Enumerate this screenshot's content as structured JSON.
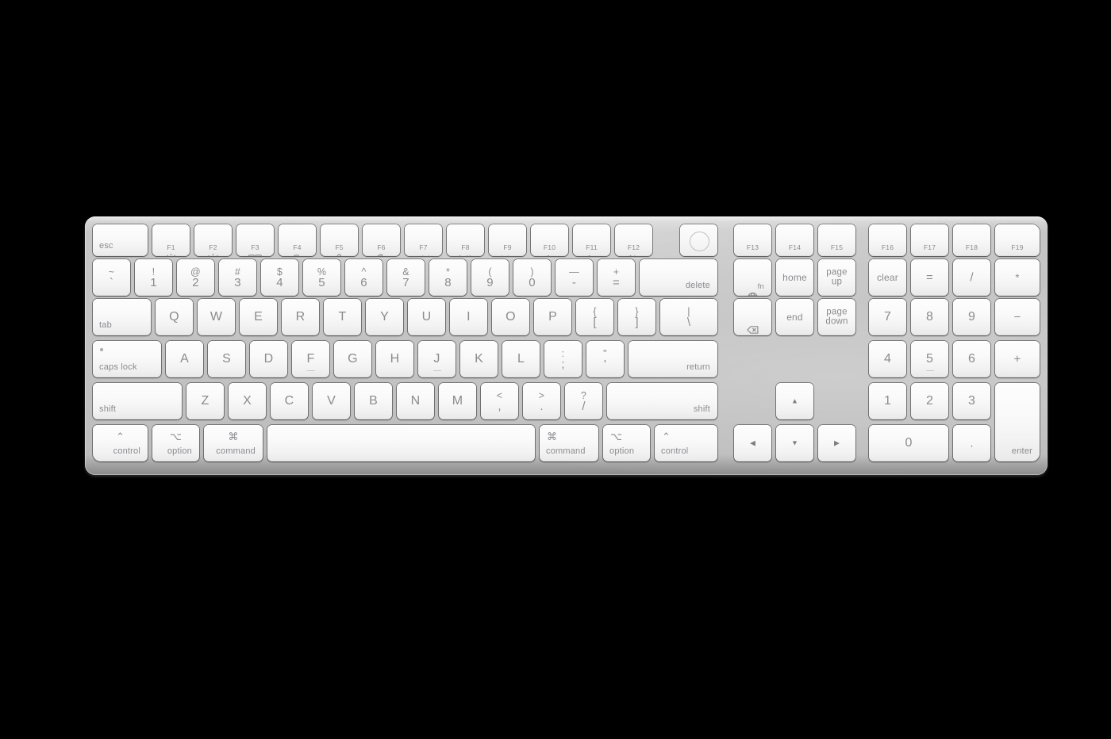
{
  "product": {
    "name": "Magic Keyboard with Touch ID and Numeric Keypad",
    "layout": "US English",
    "body_color": "#c2c2c2",
    "key_color": "#fafafa",
    "legend_color": "#8b8b8f"
  },
  "rows": {
    "function_row": [
      {
        "name": "esc",
        "label": "esc"
      },
      {
        "name": "f1",
        "icon": "brightness-down-icon",
        "fnum": "F1"
      },
      {
        "name": "f2",
        "icon": "brightness-up-icon",
        "fnum": "F2"
      },
      {
        "name": "f3",
        "icon": "mission-control-icon",
        "fnum": "F3"
      },
      {
        "name": "f4",
        "icon": "spotlight-search-icon",
        "fnum": "F4"
      },
      {
        "name": "f5",
        "icon": "dictation-microphone-icon",
        "fnum": "F5"
      },
      {
        "name": "f6",
        "icon": "do-not-disturb-moon-icon",
        "fnum": "F6"
      },
      {
        "name": "f7",
        "icon": "rewind-icon",
        "fnum": "F7"
      },
      {
        "name": "f8",
        "icon": "play-pause-icon",
        "fnum": "F8"
      },
      {
        "name": "f9",
        "icon": "fast-forward-icon",
        "fnum": "F9"
      },
      {
        "name": "f10",
        "icon": "mute-icon",
        "fnum": "F10"
      },
      {
        "name": "f11",
        "icon": "volume-down-icon",
        "fnum": "F11"
      },
      {
        "name": "f12",
        "icon": "volume-up-icon",
        "fnum": "F12"
      },
      {
        "name": "touch-id",
        "icon": "touch-id-icon"
      }
    ],
    "number_row": [
      {
        "name": "backtick",
        "top": "~",
        "bottom": "`"
      },
      {
        "name": "digit-1",
        "top": "!",
        "bottom": "1"
      },
      {
        "name": "digit-2",
        "top": "@",
        "bottom": "2"
      },
      {
        "name": "digit-3",
        "top": "#",
        "bottom": "3"
      },
      {
        "name": "digit-4",
        "top": "$",
        "bottom": "4"
      },
      {
        "name": "digit-5",
        "top": "%",
        "bottom": "5"
      },
      {
        "name": "digit-6",
        "top": "^",
        "bottom": "6"
      },
      {
        "name": "digit-7",
        "top": "&",
        "bottom": "7"
      },
      {
        "name": "digit-8",
        "top": "*",
        "bottom": "8"
      },
      {
        "name": "digit-9",
        "top": "(",
        "bottom": "9"
      },
      {
        "name": "digit-0",
        "top": ")",
        "bottom": "0"
      },
      {
        "name": "minus",
        "top": "—",
        "bottom": "-"
      },
      {
        "name": "equal",
        "top": "+",
        "bottom": "="
      },
      {
        "name": "delete",
        "label": "delete"
      }
    ],
    "top_letter_row": [
      {
        "name": "tab",
        "label": "tab"
      },
      {
        "name": "key-q",
        "label": "Q"
      },
      {
        "name": "key-w",
        "label": "W"
      },
      {
        "name": "key-e",
        "label": "E"
      },
      {
        "name": "key-r",
        "label": "R"
      },
      {
        "name": "key-t",
        "label": "T"
      },
      {
        "name": "key-y",
        "label": "Y"
      },
      {
        "name": "key-u",
        "label": "U"
      },
      {
        "name": "key-i",
        "label": "I"
      },
      {
        "name": "key-o",
        "label": "O"
      },
      {
        "name": "key-p",
        "label": "P"
      },
      {
        "name": "bracket-left",
        "top": "{",
        "bottom": "["
      },
      {
        "name": "bracket-right",
        "top": "}",
        "bottom": "]"
      },
      {
        "name": "backslash",
        "top": "|",
        "bottom": "\\"
      }
    ],
    "home_row": [
      {
        "name": "caps-lock",
        "label": "caps lock"
      },
      {
        "name": "key-a",
        "label": "A"
      },
      {
        "name": "key-s",
        "label": "S"
      },
      {
        "name": "key-d",
        "label": "D"
      },
      {
        "name": "key-f",
        "label": "F"
      },
      {
        "name": "key-g",
        "label": "G"
      },
      {
        "name": "key-h",
        "label": "H"
      },
      {
        "name": "key-j",
        "label": "J"
      },
      {
        "name": "key-k",
        "label": "K"
      },
      {
        "name": "key-l",
        "label": "L"
      },
      {
        "name": "semicolon",
        "top": ":",
        "bottom": ";"
      },
      {
        "name": "quote",
        "top": "\"",
        "bottom": "'"
      },
      {
        "name": "return",
        "label": "return"
      }
    ],
    "bottom_letter_row": [
      {
        "name": "shift-left",
        "label": "shift"
      },
      {
        "name": "key-z",
        "label": "Z"
      },
      {
        "name": "key-x",
        "label": "X"
      },
      {
        "name": "key-c",
        "label": "C"
      },
      {
        "name": "key-v",
        "label": "V"
      },
      {
        "name": "key-b",
        "label": "B"
      },
      {
        "name": "key-n",
        "label": "N"
      },
      {
        "name": "key-m",
        "label": "M"
      },
      {
        "name": "comma",
        "top": "<",
        "bottom": ","
      },
      {
        "name": "period",
        "top": ">",
        "bottom": "."
      },
      {
        "name": "slash",
        "top": "?",
        "bottom": "/"
      },
      {
        "name": "shift-right",
        "label": "shift"
      }
    ],
    "modifier_row": [
      {
        "name": "control-left",
        "glyph": "⌃",
        "label": "control"
      },
      {
        "name": "option-left",
        "glyph": "⌥",
        "label": "option"
      },
      {
        "name": "command-left",
        "glyph": "⌘",
        "label": "command"
      },
      {
        "name": "space",
        "label": ""
      },
      {
        "name": "command-right",
        "glyph": "⌘",
        "label": "command"
      },
      {
        "name": "option-right",
        "glyph": "⌥",
        "label": "option"
      },
      {
        "name": "control-right",
        "glyph": "⌃",
        "label": "control"
      }
    ]
  },
  "f13_row": [
    {
      "name": "f13",
      "fnum": "F13"
    },
    {
      "name": "f14",
      "fnum": "F14"
    },
    {
      "name": "f15",
      "fnum": "F15"
    },
    {
      "name": "f16",
      "fnum": "F16"
    },
    {
      "name": "f17",
      "fnum": "F17"
    },
    {
      "name": "f18",
      "fnum": "F18"
    },
    {
      "name": "f19",
      "fnum": "F19"
    }
  ],
  "nav_cluster": [
    {
      "name": "fn-globe",
      "icon": "globe-icon",
      "label": "fn"
    },
    {
      "name": "home",
      "label": "home"
    },
    {
      "name": "page-up",
      "line1": "page",
      "line2": "up"
    },
    {
      "name": "forward-delete",
      "icon": "forward-delete-icon"
    },
    {
      "name": "end",
      "label": "end"
    },
    {
      "name": "page-down",
      "line1": "page",
      "line2": "down"
    }
  ],
  "arrow_cluster": [
    {
      "name": "arrow-up",
      "glyph": "▲"
    },
    {
      "name": "arrow-left",
      "glyph": "◀"
    },
    {
      "name": "arrow-down",
      "glyph": "▼"
    },
    {
      "name": "arrow-right",
      "glyph": "▶"
    }
  ],
  "numeric_keypad": [
    {
      "name": "num-clear",
      "label": "clear"
    },
    {
      "name": "num-equal",
      "label": "="
    },
    {
      "name": "num-divide",
      "label": "/"
    },
    {
      "name": "num-multiply",
      "label": "*"
    },
    {
      "name": "num-7",
      "label": "7"
    },
    {
      "name": "num-8",
      "label": "8"
    },
    {
      "name": "num-9",
      "label": "9"
    },
    {
      "name": "num-minus",
      "label": "−"
    },
    {
      "name": "num-4",
      "label": "4"
    },
    {
      "name": "num-5",
      "label": "5"
    },
    {
      "name": "num-6",
      "label": "6"
    },
    {
      "name": "num-plus",
      "label": "+"
    },
    {
      "name": "num-1",
      "label": "1"
    },
    {
      "name": "num-2",
      "label": "2"
    },
    {
      "name": "num-3",
      "label": "3"
    },
    {
      "name": "num-0",
      "label": "0"
    },
    {
      "name": "num-decimal",
      "label": "."
    },
    {
      "name": "num-enter",
      "label": "enter"
    }
  ]
}
